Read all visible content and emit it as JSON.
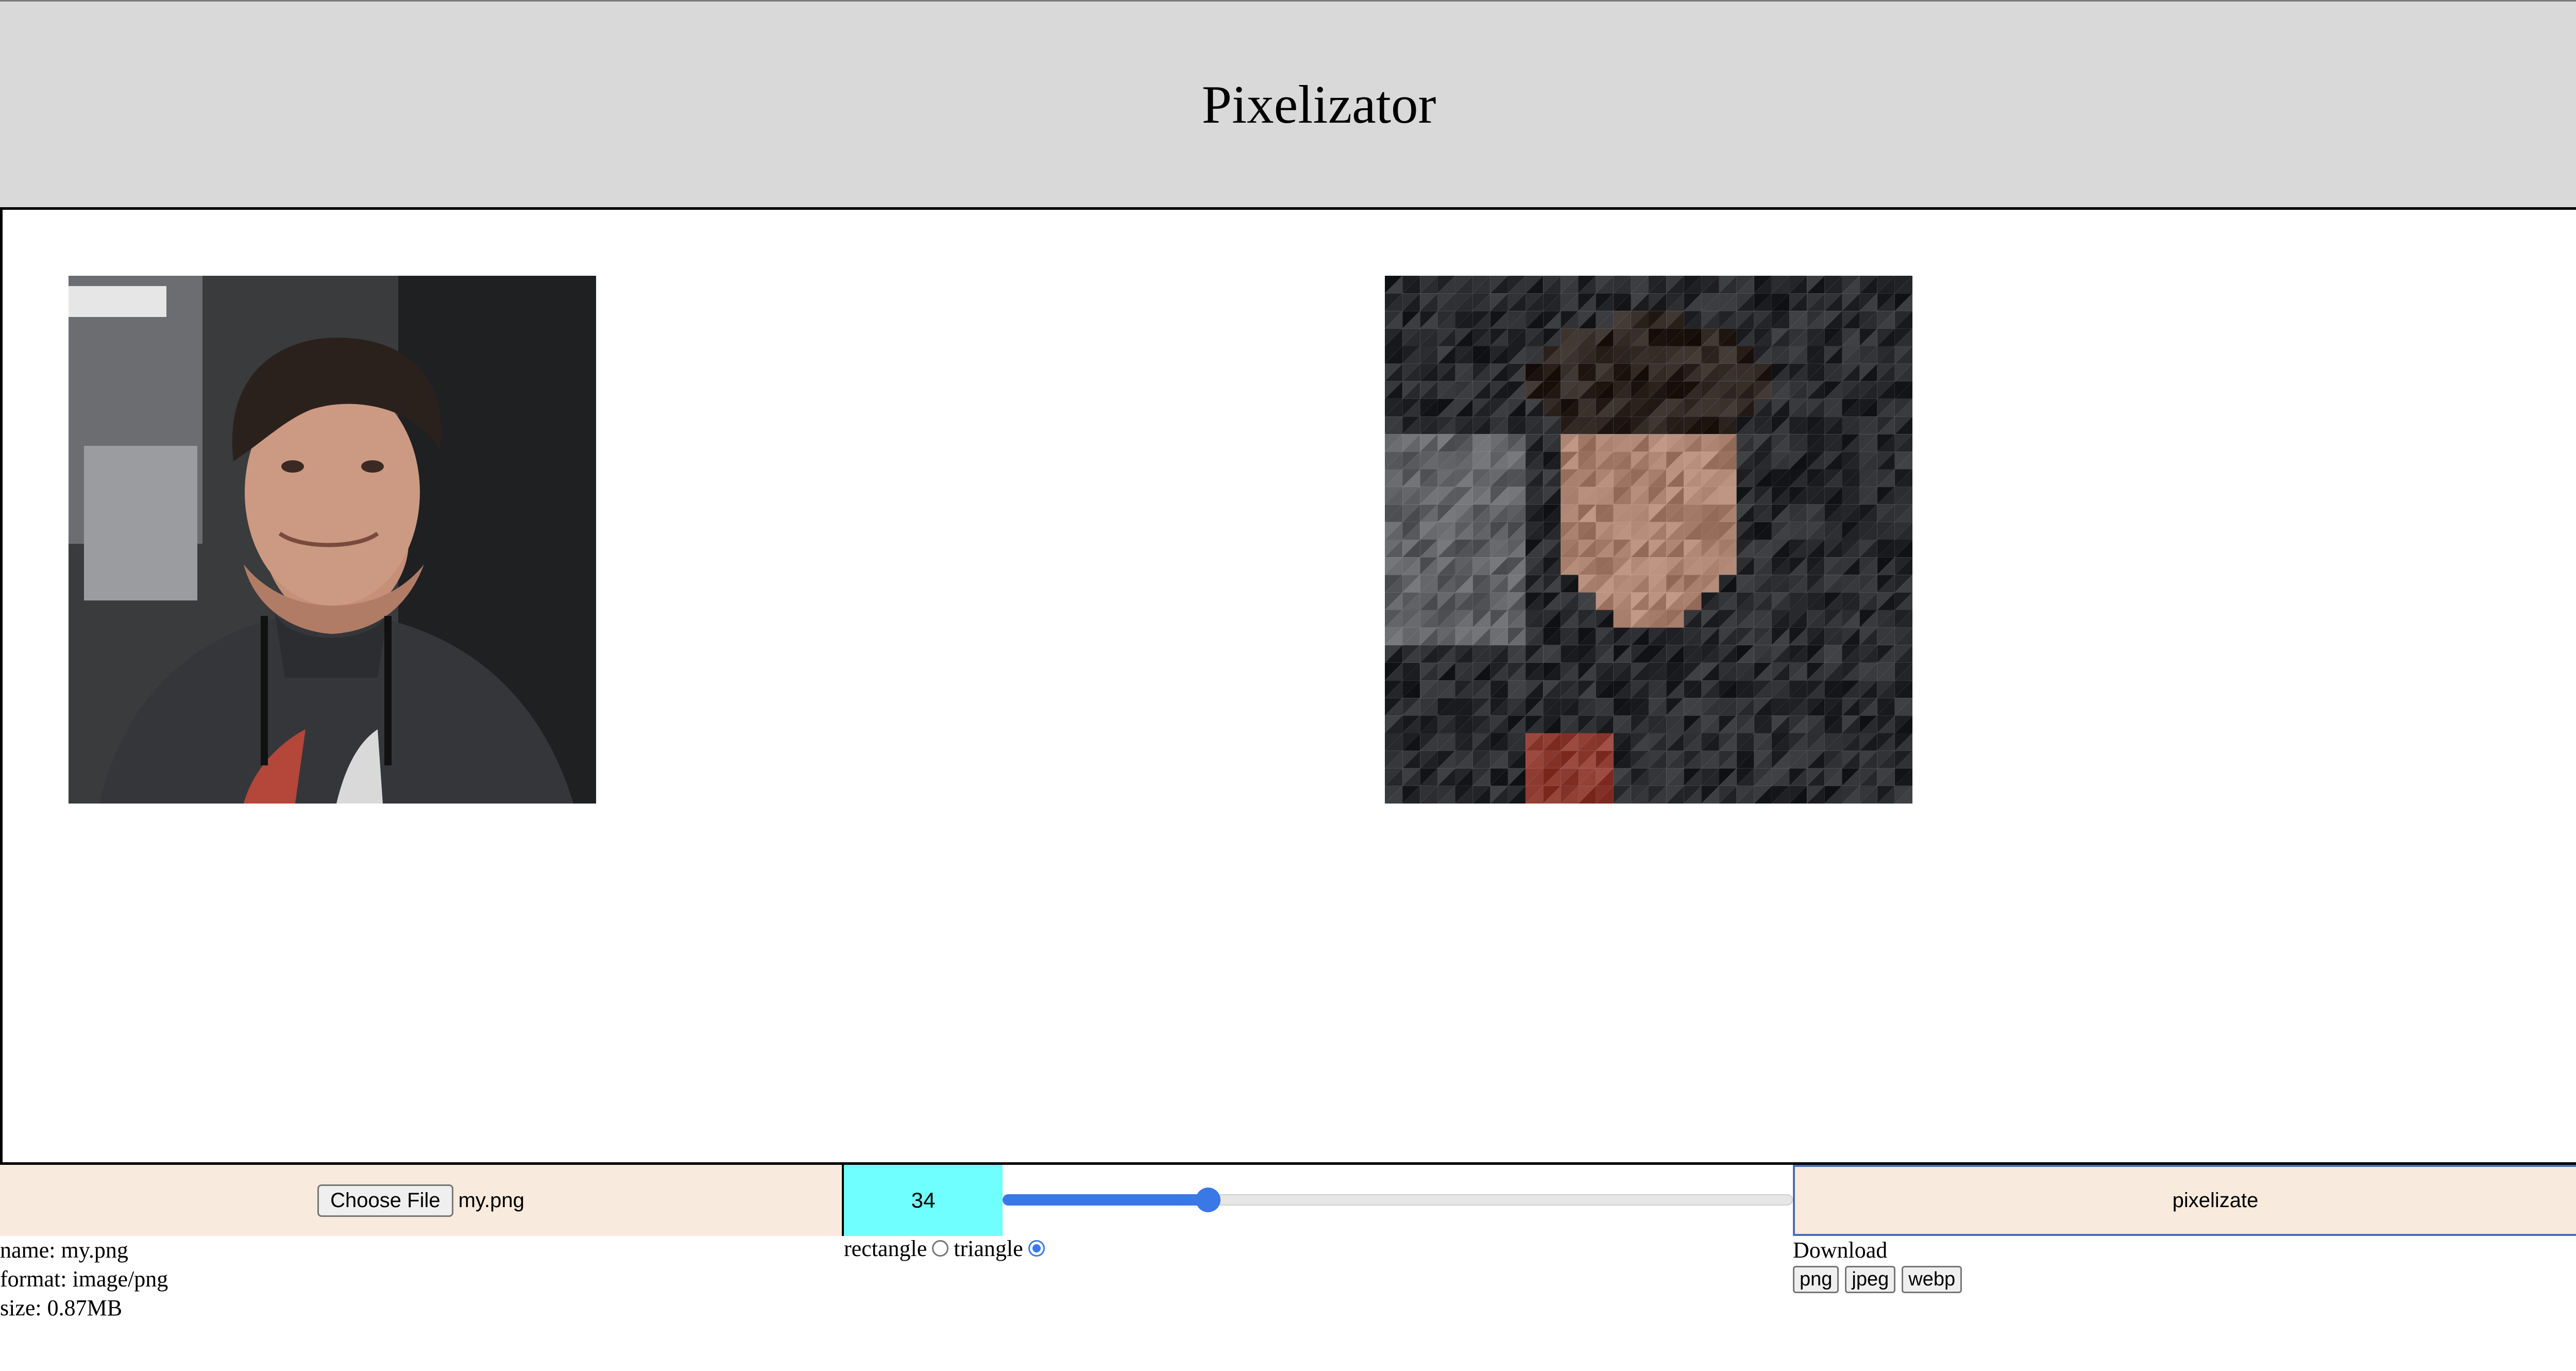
{
  "header": {
    "title": "Pixelizator"
  },
  "images": {
    "original": {
      "name": "original-photo"
    },
    "pixelated": {
      "name": "pixelated-photo"
    }
  },
  "controls": {
    "choose_file_label": "Choose File",
    "file_name": "my.png",
    "size_value": "34",
    "slider_fraction": 0.26,
    "pixelizate_label": "pixelizate"
  },
  "info": {
    "name": "name: my.png",
    "format": "format: image/png",
    "size": "size: 0.87MB"
  },
  "shape": {
    "rectangle_label": "rectangle",
    "triangle_label": "triangle",
    "selected": "triangle"
  },
  "download": {
    "title": "Download",
    "png": "png",
    "jpeg": "jpeg",
    "webp": "webp"
  },
  "colors": {
    "header_bg": "#d9d9d9",
    "file_area_bg": "#f8eadc",
    "size_box_bg": "#70ffff",
    "accent": "#3b78e7"
  }
}
